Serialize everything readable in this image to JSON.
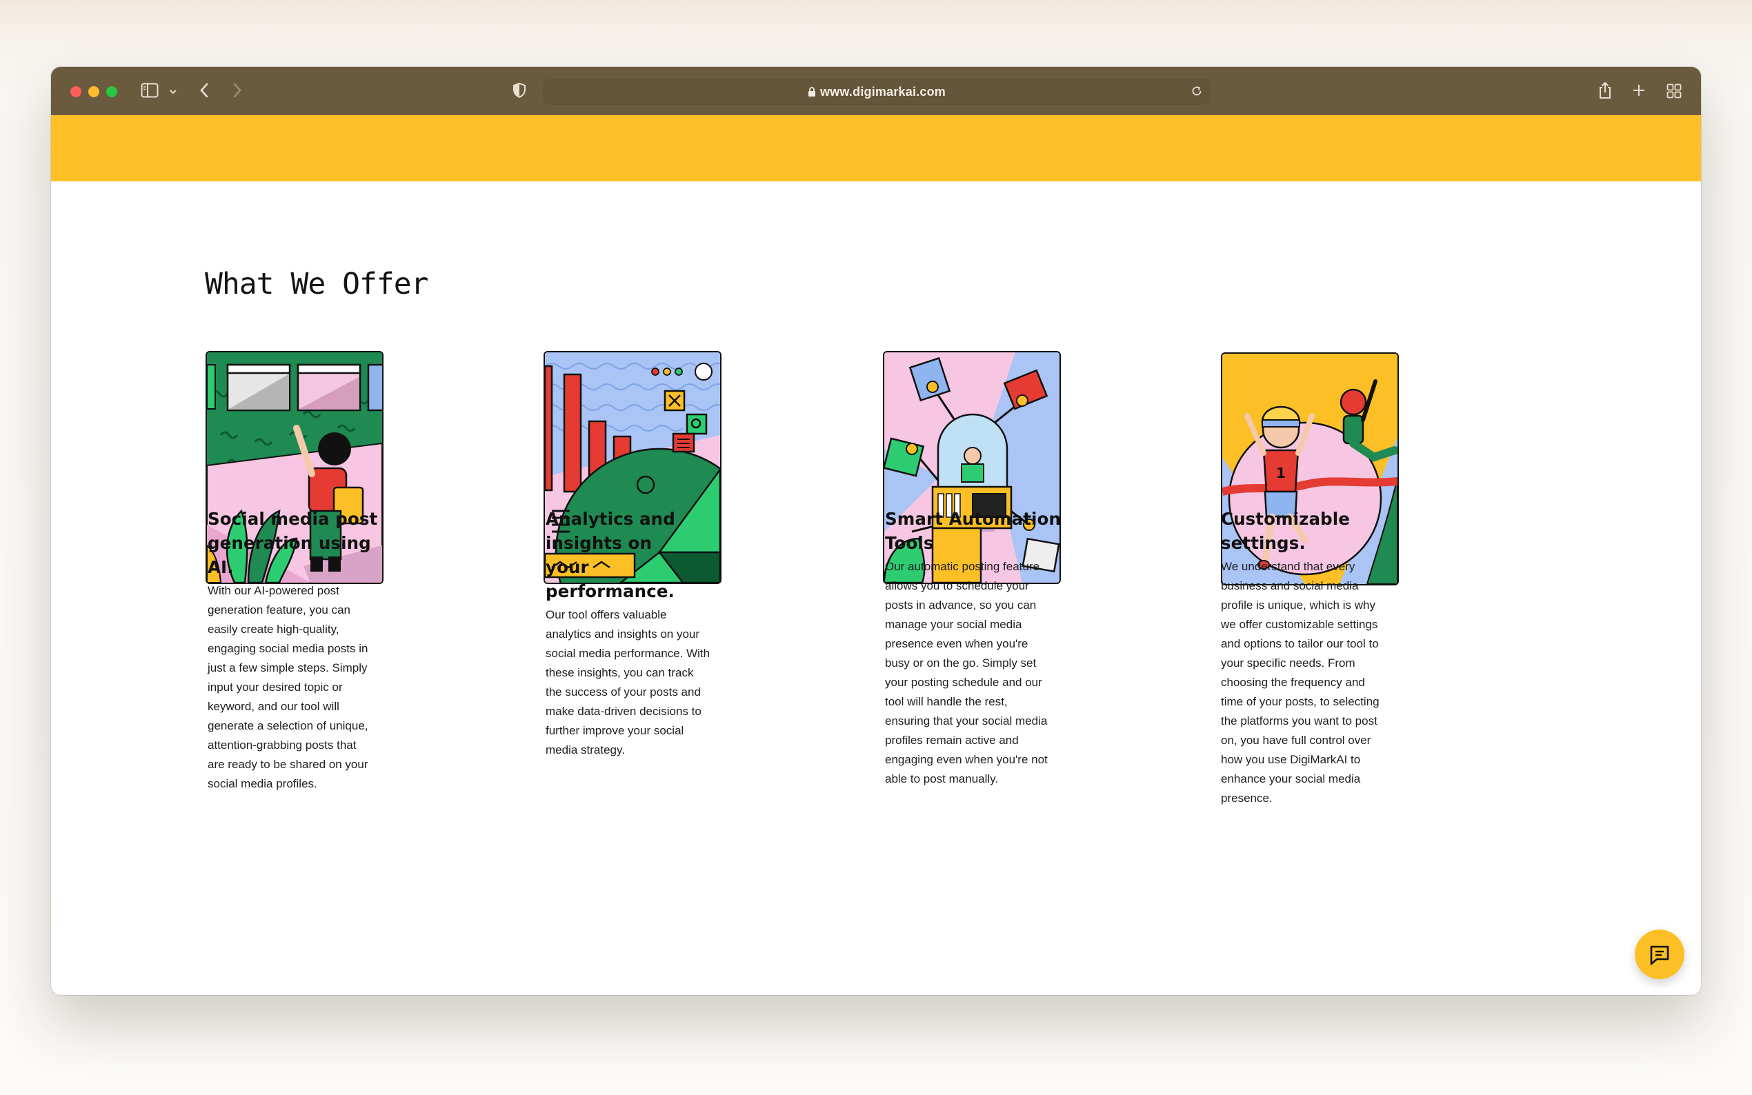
{
  "browser": {
    "url": "www.digimarkai.com",
    "traffic_lights": [
      "#ff5f57",
      "#febc2e",
      "#28c840"
    ],
    "toolbar_color": "#6a5a3e"
  },
  "banner": {
    "color": "#fcbf26"
  },
  "section": {
    "heading": "What We Offer",
    "cards": [
      {
        "title_lines": [
          "Social media post",
          "generation using",
          "AI."
        ],
        "body_lines": [
          "With our AI-powered post",
          "generation feature, you can",
          "easily create high-quality,",
          "engaging social media posts in",
          "just a few simple steps. Simply",
          "input your desired topic or",
          "keyword, and our tool will",
          "generate a selection of unique,",
          "attention-grabbing posts that",
          "are ready to be shared on your",
          "social media profiles."
        ],
        "illustration": "person-at-windows-illustration"
      },
      {
        "title_lines": [
          "Analytics and",
          "insights on",
          "your",
          "performance."
        ],
        "body_lines": [
          "Our tool offers valuable",
          "analytics and insights on your",
          "social media performance. With",
          "these insights, you can track",
          "the success of your posts and",
          "make data-driven decisions to",
          "further improve your social",
          "media strategy."
        ],
        "illustration": "bar-and-pie-chart-illustration"
      },
      {
        "title_lines": [
          "Smart Automation",
          "Tools"
        ],
        "body_lines": [
          "Our automatic posting feature",
          "allows you to schedule your",
          "posts in advance, so you can",
          "manage your social media",
          "presence even when you're",
          "busy or on the go. Simply set",
          "your posting schedule and our",
          "tool will handle the rest,",
          "ensuring that your social media",
          "profiles remain active and",
          "engaging even when you're not",
          "able to post manually."
        ],
        "illustration": "robot-arms-illustration"
      },
      {
        "title_lines": [
          "Customizable",
          "settings."
        ],
        "body_lines": [
          "We understand that every",
          "business and social media",
          "profile is unique, which is why",
          "we offer customizable settings",
          "and options to tailor our tool to",
          "your specific needs. From",
          "choosing the frequency and",
          "time of your posts, to selecting",
          "the platforms you want to post",
          "on, you have full control over",
          "how you use DigiMarkAI to",
          "enhance your social media",
          "presence."
        ],
        "illustration": "runners-finish-line-illustration"
      }
    ]
  },
  "chat_button": {
    "icon": "chat-icon",
    "color": "#fcbf26"
  }
}
